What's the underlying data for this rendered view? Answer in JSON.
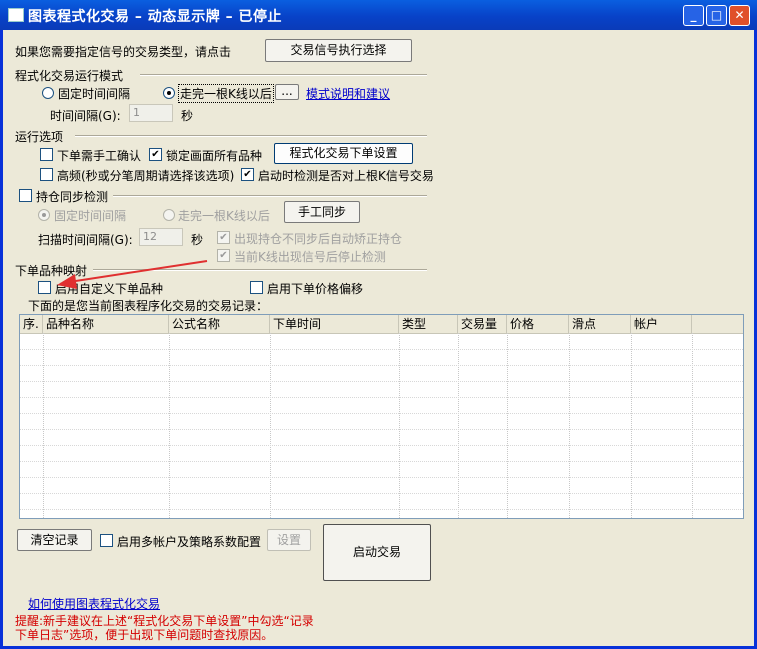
{
  "window": {
    "title": "图表程式化交易 – 动态显示牌 – 已停止",
    "minimize": "_",
    "maximize": "□",
    "close": "✕"
  },
  "top": {
    "prompt": "如果您需要指定信号的交易类型，请点击",
    "signal_button": "交易信号执行选择"
  },
  "run_mode": {
    "heading": "程式化交易运行模式",
    "option_fixed": "固定时间间隔",
    "option_bar": "走完一根K线以后",
    "selected": "option_bar",
    "dots_button": "...",
    "help_link": "模式说明和建议",
    "interval_label": "时间间隔(G):",
    "interval_value": "1",
    "interval_unit": "秒"
  },
  "run_options": {
    "heading": "运行选项",
    "manual_confirm": {
      "label": "下单需手工确认",
      "checked": false
    },
    "lock_all": {
      "label": "锁定画面所有品种",
      "checked": true
    },
    "order_settings_button": "程式化交易下单设置",
    "high_freq": {
      "label": "高频(秒或分笔周期请选择该选项)",
      "checked": false
    },
    "startup_check": {
      "label": "启动时检测是否对上根K信号交易",
      "checked": true
    }
  },
  "position_sync": {
    "heading": "持仓同步检测",
    "checked": false,
    "option_fixed": "固定时间间隔",
    "option_bar": "走完一根K线以后",
    "manual_sync_button": "手工同步",
    "scan_label": "扫描时间间隔(G):",
    "scan_value": "12",
    "scan_unit": "秒",
    "auto_fix": {
      "label": "出现持仓不同步后自动矫正持仓",
      "checked": true
    },
    "stop_check": {
      "label": "当前K线出现信号后停止检测",
      "checked": true
    }
  },
  "mapping": {
    "heading": "下单品种映射",
    "custom_symbol": {
      "label": "启用自定义下单品种",
      "checked": false
    },
    "price_offset": {
      "label": "启用下单价格偏移",
      "checked": false
    },
    "records_caption": "下面的是您当前图表程序化交易的交易记录："
  },
  "table": {
    "columns": [
      "序.",
      "品种名称",
      "公式名称",
      "下单时间",
      "类型",
      "交易量",
      "价格",
      "滑点",
      "帐户"
    ]
  },
  "bottom": {
    "clear_button": "清空记录",
    "multi_account": {
      "label": "启用多帐户及策略系数配置",
      "checked": false
    },
    "settings_button": "设置",
    "start_button": "启动交易",
    "howto_link": "如何使用图表程式化交易",
    "tip_line1": "提醒:新手建议在上述“程式化交易下单设置”中勾选“记录",
    "tip_line2": "下单日志”选项，便于出现下单问题时查找原因。"
  },
  "colors": {
    "titlebar": "#0842c8",
    "window_bg": "#ece9d8",
    "tip_text": "#d40000",
    "arrow": "#e03030",
    "link": "#0000cc"
  }
}
